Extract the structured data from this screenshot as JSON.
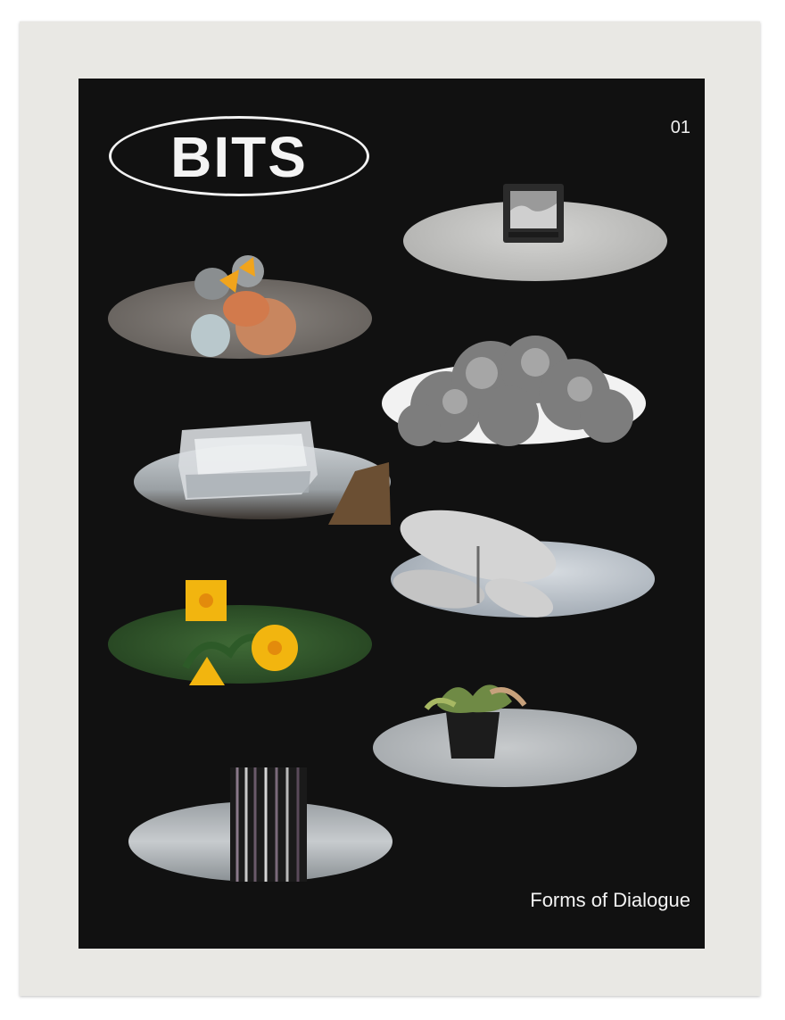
{
  "cover": {
    "logo": "BITS",
    "issue_number": "01",
    "subtitle": "Forms of Dialogue"
  },
  "colors": {
    "background": "#111111",
    "paper": "#e9e8e4",
    "text": "#f4f4f4",
    "flower_yellow": "#f2b50f"
  },
  "collage": [
    {
      "name": "television-image"
    },
    {
      "name": "baby-birds-image"
    },
    {
      "name": "cloud-image"
    },
    {
      "name": "ice-block-image"
    },
    {
      "name": "satellite-dishes-image"
    },
    {
      "name": "yellow-flowers-image"
    },
    {
      "name": "potted-plant-image"
    },
    {
      "name": "glitch-screen-image"
    }
  ]
}
